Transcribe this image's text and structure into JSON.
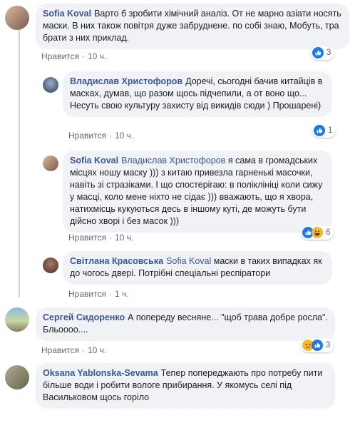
{
  "comments": [
    {
      "author": "Sofia Koval",
      "text": "Варто б зробити хімічний аналіз. От не марно азіати носять маски. В них також повітря дуже забруднене. по собі знаю, Мобуть, тра брати з них приклад.",
      "like_label": "Нравится",
      "time": "10 ч.",
      "reaction_count": "3",
      "reactions": [
        "like-icon"
      ]
    },
    {
      "author": "Владислав Христофоров",
      "text": "Доречі, сьогодні бачив китайців в масках, думав, що разом щось підчепили, а от воно що... Несуть свою культуру захисту від викидів сюди ) Прошарені)",
      "like_label": "Нравится",
      "time": "10 ч.",
      "reaction_count": "1",
      "reactions": [
        "like-icon"
      ]
    },
    {
      "author": "Sofia Koval",
      "mention": "Владислав Христофоров",
      "text": "я сама в громадських місцях ношу маску ))) з китаю привезла гарненькі масочки, навіть зі стразіками. І що спостерігаю: в поліклініці коли сижу у масці, коло мене ніхто не сідає ))) вважають, що я хвора, натихмісць кукуються десь в іншому куті, де можуть бути дійсно хворі і без масок )))",
      "like_label": "Нравится",
      "time": "10 ч.",
      "reaction_count": "6",
      "reactions": [
        "like-icon",
        "haha-icon"
      ]
    },
    {
      "author": "Світлана Красовська",
      "mention": "Sofia Koval",
      "text": "маски в таких випадках як до чогось двері. Потрібні спеціальні респіратори",
      "like_label": "Нравится",
      "time": "1 ч."
    },
    {
      "author": "Сергей Сидоренко",
      "text": "А попереду весняне... \"щоб трава добре росла\". Бльоооо....",
      "like_label": "Нравится",
      "time": "10 ч.",
      "reaction_count": "3",
      "reactions": [
        "sad-icon",
        "like-icon"
      ]
    },
    {
      "author": "Oksana Yablonska-Sevama",
      "text": "Тепер попереджають про потребу пити більше води і робити вологе прибирання. У якомусь селі під Васильковом щось горіло"
    }
  ],
  "colors": {
    "link": "#385898",
    "bubble": "#f0f2f5",
    "like": "#1877f2",
    "haha": "#f7b928"
  }
}
